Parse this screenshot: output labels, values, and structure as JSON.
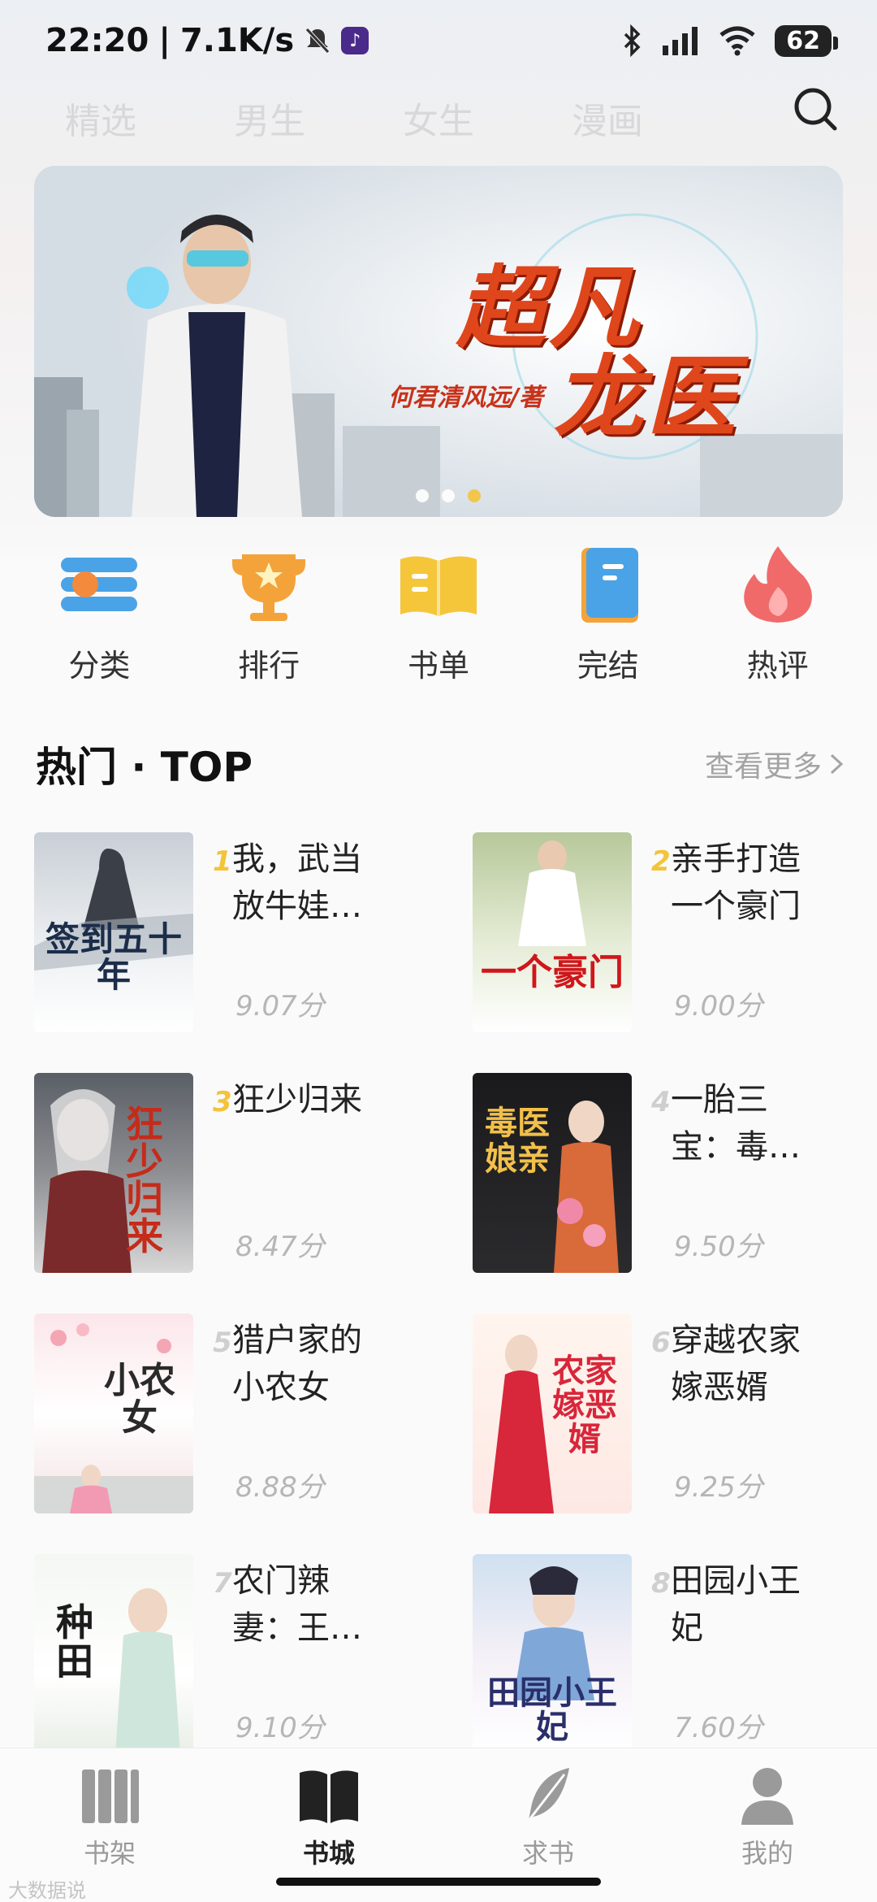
{
  "status": {
    "time": "22:20",
    "speed": "7.1K/s",
    "battery": "62"
  },
  "top_tabs": [
    "精选",
    "男生",
    "女生",
    "漫画"
  ],
  "banner": {
    "title_line1": "超凡",
    "title_line2": "龙医",
    "author": "何君清风远/著",
    "dots": 3,
    "active_dot": 2
  },
  "quick_nav": [
    {
      "label": "分类",
      "icon": "category-icon"
    },
    {
      "label": "排行",
      "icon": "trophy-icon"
    },
    {
      "label": "书单",
      "icon": "book-list-icon"
    },
    {
      "label": "完结",
      "icon": "finished-book-icon"
    },
    {
      "label": "热评",
      "icon": "fire-icon"
    }
  ],
  "section": {
    "title": "热门 · TOP",
    "more": "查看更多"
  },
  "books": [
    {
      "rank": "1",
      "title": "我，武当放牛娃…",
      "score": "9.07分",
      "cover_text": "签到五十年"
    },
    {
      "rank": "2",
      "title": "亲手打造一个豪门",
      "score": "9.00分",
      "cover_text": "一个豪门"
    },
    {
      "rank": "3",
      "title": "狂少归来",
      "score": "8.47分",
      "cover_text": "狂少归来"
    },
    {
      "rank": "4",
      "title": "一胎三宝：毒…",
      "score": "9.50分",
      "cover_text": "毒医娘亲"
    },
    {
      "rank": "5",
      "title": "猎户家的小农女",
      "score": "8.88分",
      "cover_text": "小农女"
    },
    {
      "rank": "6",
      "title": "穿越农家嫁恶婿",
      "score": "9.25分",
      "cover_text": "农家嫁恶婿"
    },
    {
      "rank": "7",
      "title": "农门辣妻：王…",
      "score": "9.10分",
      "cover_text": "种田"
    },
    {
      "rank": "8",
      "title": "田园小王妃",
      "score": "7.60分",
      "cover_text": "田园小王妃"
    }
  ],
  "bottom_nav": [
    {
      "label": "书架",
      "icon": "bookshelf-icon",
      "active": false
    },
    {
      "label": "书城",
      "icon": "open-book-icon",
      "active": true
    },
    {
      "label": "求书",
      "icon": "feather-icon",
      "active": false
    },
    {
      "label": "我的",
      "icon": "user-icon",
      "active": false
    }
  ],
  "colors": {
    "accent": "#f3c33a",
    "text": "#222222",
    "muted": "#9a9a9a"
  },
  "watermark": "大数据说"
}
